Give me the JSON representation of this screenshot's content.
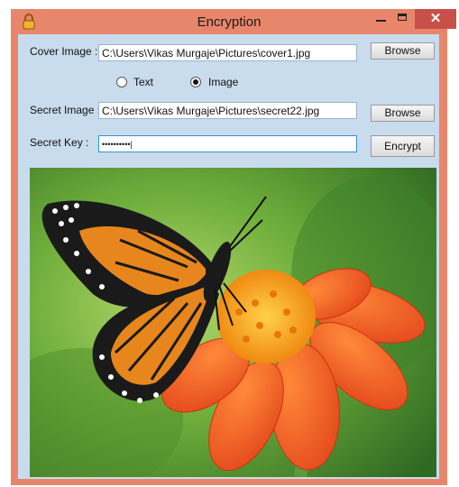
{
  "window": {
    "title": "Encryption",
    "close_glyph": "✕"
  },
  "form": {
    "cover_label": "Cover Image :",
    "cover_path": "C:\\Users\\Vikas Murgaje\\Pictures\\cover1.jpg",
    "browse_label_1": "Browse",
    "radio_text_label": "Text",
    "radio_image_label": "Image",
    "selected_mode": "Image",
    "secret_label": "Secret Image :",
    "secret_path": "C:\\Users\\Vikas Murgaje\\Pictures\\secret22.jpg",
    "browse_label_2": "Browse",
    "key_label": "Secret Key :",
    "key_value": "••••••••••|",
    "encrypt_label": "Encrypt"
  },
  "picture": {
    "subject": "monarch butterfly on orange flower",
    "icon": "image-preview"
  },
  "colors": {
    "titlebar": "#e8866c",
    "close": "#c7504a",
    "client_bg": "#c9dcee"
  }
}
